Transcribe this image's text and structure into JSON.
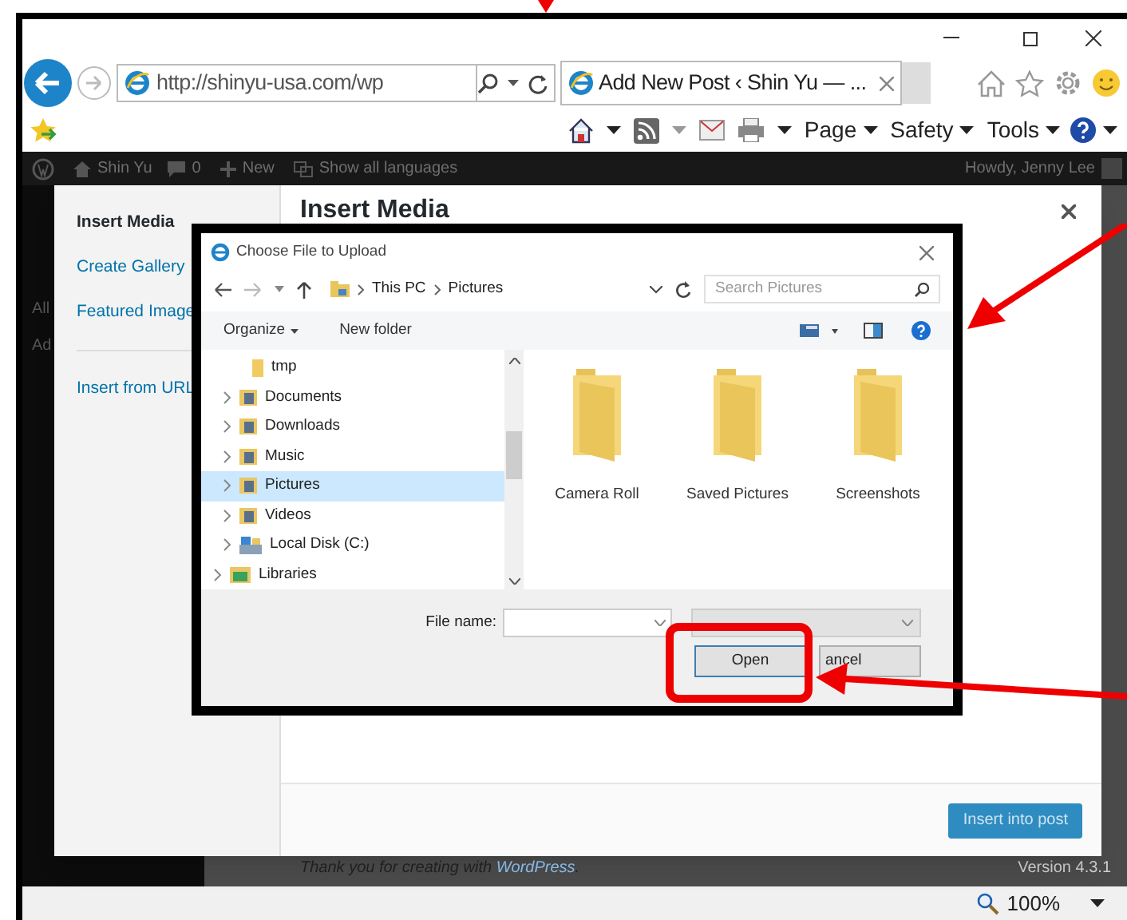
{
  "browser": {
    "address": "http://shinyu-usa.com/wp",
    "tab_title": "Add New Post ‹ Shin Yu — ...",
    "command_bar": [
      {
        "label": "Page"
      },
      {
        "label": "Safety"
      },
      {
        "label": "Tools"
      }
    ]
  },
  "admin_bar": {
    "site": "Shin Yu",
    "comments": "0",
    "new": "New",
    "languages": "Show all languages",
    "greeting": "Howdy, Jenny Lee"
  },
  "admin_menu": [
    "All",
    "Ad"
  ],
  "media_modal": {
    "title": "Insert Media",
    "menu": [
      {
        "label": "Insert Media",
        "selected": true,
        "separated": false
      },
      {
        "label": "Create Gallery",
        "selected": false,
        "separated": false
      },
      {
        "label": "Featured Image",
        "selected": false,
        "separated": false
      },
      {
        "label": "Insert from URL",
        "selected": false,
        "separated": true
      }
    ],
    "insert_button": "Insert into post"
  },
  "footer": {
    "thanks": "Thank you for creating with",
    "link": "WordPress",
    "period": ".",
    "version": "Version 4.3.1"
  },
  "status_bar": {
    "zoom": "100%"
  },
  "file_dialog": {
    "title": "Choose File to Upload",
    "breadcrumb": [
      "This PC",
      "Pictures"
    ],
    "search_placeholder": "Search Pictures",
    "organize": "Organize",
    "new_folder": "New folder",
    "tree": [
      {
        "label": "tmp",
        "kind": "subfolder",
        "selected": false
      },
      {
        "label": "Documents",
        "kind": "folder",
        "selected": false
      },
      {
        "label": "Downloads",
        "kind": "folder",
        "selected": false
      },
      {
        "label": "Music",
        "kind": "folder",
        "selected": false
      },
      {
        "label": "Pictures",
        "kind": "folder",
        "selected": true
      },
      {
        "label": "Videos",
        "kind": "folder",
        "selected": false
      },
      {
        "label": "Local Disk (C:)",
        "kind": "drive",
        "selected": false
      },
      {
        "label": "Libraries",
        "kind": "root",
        "selected": false
      }
    ],
    "folders": [
      "Camera Roll",
      "Saved Pictures",
      "Screenshots"
    ],
    "file_name_label": "File name:",
    "buttons": [
      {
        "label": "Open",
        "kind": "primary"
      },
      {
        "label": "ancel",
        "kind": "secondary"
      }
    ]
  }
}
